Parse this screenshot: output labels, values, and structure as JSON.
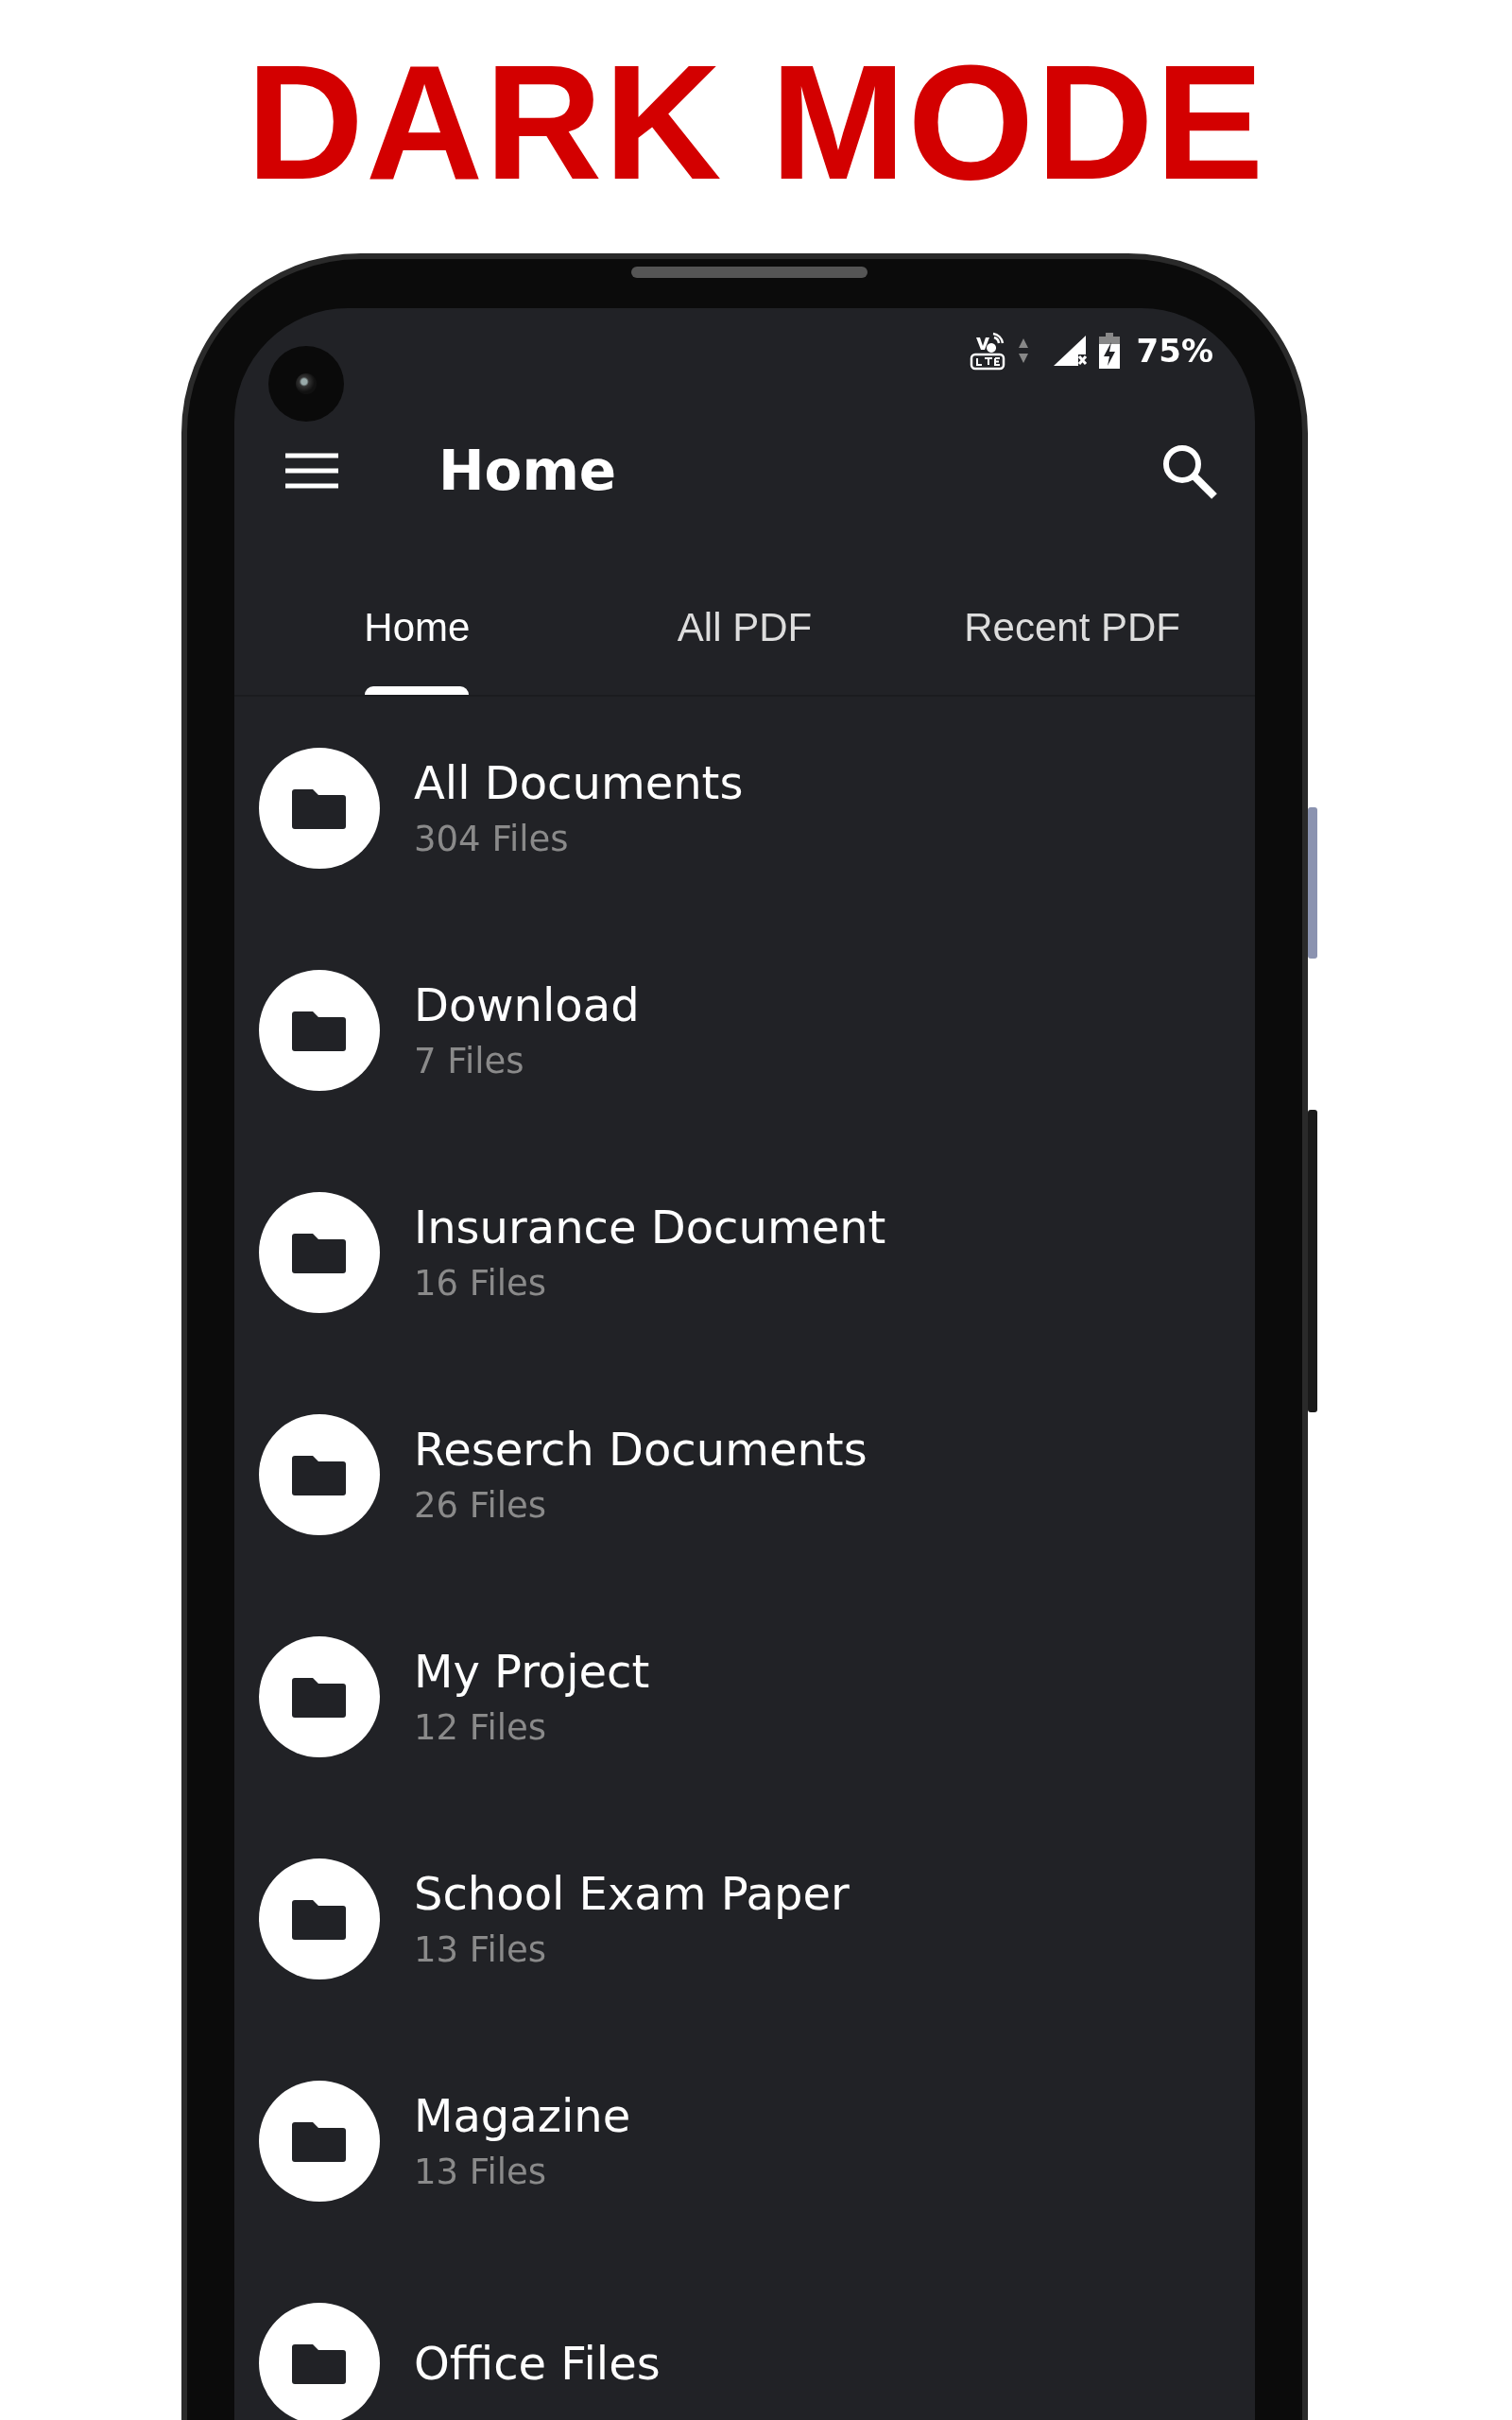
{
  "headline": "DARK MODE",
  "status_bar": {
    "battery": "75%"
  },
  "toolbar": {
    "title": "Home"
  },
  "tabs": [
    {
      "label": "Home",
      "selected": true
    },
    {
      "label": "All PDF",
      "selected": false
    },
    {
      "label": "Recent PDF",
      "selected": false
    }
  ],
  "folders": [
    {
      "name": "All Documents",
      "count": "304 Files"
    },
    {
      "name": "Download",
      "count": "7 Files"
    },
    {
      "name": "Insurance Document",
      "count": "16 Files"
    },
    {
      "name": "Reserch Documents",
      "count": "26 Files"
    },
    {
      "name": "My Project",
      "count": "12 Files"
    },
    {
      "name": "School Exam Paper",
      "count": "13 Files"
    },
    {
      "name": "Magazine",
      "count": "13 Files"
    },
    {
      "name": "Office Files"
    }
  ]
}
